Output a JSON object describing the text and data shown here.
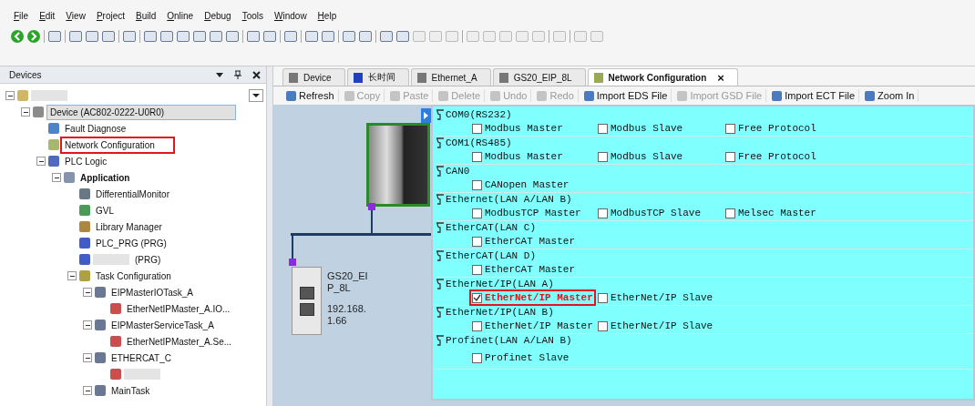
{
  "menu": [
    {
      "label": "File"
    },
    {
      "label": "Edit"
    },
    {
      "label": "View"
    },
    {
      "label": "Project"
    },
    {
      "label": "Build"
    },
    {
      "label": "Online"
    },
    {
      "label": "Debug"
    },
    {
      "label": "Tools"
    },
    {
      "label": "Window"
    },
    {
      "label": "Help"
    }
  ],
  "devices_panel": {
    "title": "Devices",
    "tree": [
      {
        "kind": "project",
        "redacted": true,
        "expanded": true,
        "children": [
          {
            "kind": "device",
            "label": "Device (AC802-0222-U0R0)",
            "selected": true,
            "expanded": true,
            "children": [
              {
                "kind": "diagnose",
                "label": "Fault Diagnose",
                "selected": false
              },
              {
                "kind": "network",
                "label": "Network Configuration",
                "highlighted": true,
                "selected": false
              },
              {
                "kind": "plc",
                "label": "PLC Logic",
                "expanded": true,
                "selected": false,
                "children": [
                  {
                    "kind": "application",
                    "label": "Application",
                    "active": true,
                    "expanded": true,
                    "selected": false,
                    "children": [
                      {
                        "kind": "monitor",
                        "label": "DifferentialMonitor",
                        "selected": false
                      },
                      {
                        "kind": "gvl",
                        "label": "GVL",
                        "selected": false
                      },
                      {
                        "kind": "library",
                        "label": "Library Manager",
                        "selected": false
                      },
                      {
                        "kind": "program",
                        "label": "PLC_PRG (PRG)",
                        "selected": false
                      },
                      {
                        "kind": "program",
                        "label": "(PRG)",
                        "redacted": true,
                        "selected": false
                      },
                      {
                        "kind": "taskconfig",
                        "label": "Task Configuration",
                        "expanded": true,
                        "selected": false,
                        "children": [
                          {
                            "kind": "task",
                            "label": "EIPMasterIOTask_A",
                            "expanded": true,
                            "selected": false,
                            "children": [
                              {
                                "kind": "call",
                                "label": "EtherNetIPMaster_A.IO...",
                                "selected": false
                              }
                            ]
                          },
                          {
                            "kind": "task",
                            "label": "EIPMasterServiceTask_A",
                            "expanded": true,
                            "selected": false,
                            "children": [
                              {
                                "kind": "call",
                                "label": "EtherNetIPMaster_A.Se...",
                                "selected": false
                              }
                            ]
                          },
                          {
                            "kind": "task",
                            "label": "ETHERCAT_C",
                            "expanded": true,
                            "selected": false,
                            "children": [
                              {
                                "kind": "call",
                                "redacted": true,
                                "selected": false
                              }
                            ]
                          },
                          {
                            "kind": "task",
                            "label": "MainTask",
                            "expanded": true,
                            "selected": false
                          }
                        ]
                      }
                    ]
                  }
                ]
              }
            ]
          }
        ]
      }
    ]
  },
  "tabs": [
    {
      "label": "Device",
      "kind": "device",
      "selected": false
    },
    {
      "label": "长时间",
      "kind": "program",
      "selected": false
    },
    {
      "label": "Ethernet_A",
      "kind": "device",
      "selected": false
    },
    {
      "label": "GS20_EIP_8L",
      "kind": "device",
      "selected": false
    },
    {
      "label": "Network Configuration",
      "kind": "network",
      "selected": true,
      "close": "×"
    }
  ],
  "toolbar": [
    {
      "label": "Refresh",
      "disabled": false
    },
    {
      "label": "Copy",
      "disabled": true
    },
    {
      "label": "Paste",
      "disabled": true
    },
    {
      "label": "Delete",
      "disabled": true
    },
    {
      "label": "Undo",
      "disabled": true
    },
    {
      "label": "Redo",
      "disabled": true
    },
    {
      "label": "Import EDS File",
      "disabled": false
    },
    {
      "label": "Import GSD File",
      "disabled": true
    },
    {
      "label": "Import ECT File",
      "disabled": false
    },
    {
      "label": "Zoom In",
      "disabled": false
    }
  ],
  "topology": {
    "node": {
      "name": "GS20_EIP_8L",
      "ip": "192.168.1.66"
    }
  },
  "protocols": [
    {
      "title": "COM0(RS232)",
      "options": [
        {
          "label": "Modbus Master",
          "checked": false
        },
        {
          "label": "Modbus Slave",
          "checked": false
        },
        {
          "label": "Free Protocol",
          "checked": false
        }
      ]
    },
    {
      "title": "COM1(RS485)",
      "options": [
        {
          "label": "Modbus Master",
          "checked": false
        },
        {
          "label": "Modbus Slave",
          "checked": false
        },
        {
          "label": "Free Protocol",
          "checked": false
        }
      ]
    },
    {
      "title": "CAN0",
      "options": [
        {
          "label": "CANopen Master",
          "checked": false
        }
      ]
    },
    {
      "title": "Ethernet(LAN A/LAN B)",
      "options": [
        {
          "label": "ModbusTCP Master",
          "checked": false
        },
        {
          "label": "ModbusTCP Slave",
          "checked": false
        },
        {
          "label": "Melsec Master",
          "checked": false
        }
      ]
    },
    {
      "title": "EtherCAT(LAN C)",
      "options": [
        {
          "label": "EtherCAT Master",
          "checked": false
        }
      ]
    },
    {
      "title": "EtherCAT(LAN D)",
      "options": [
        {
          "label": "EtherCAT Master",
          "checked": false
        }
      ]
    },
    {
      "title": "EtherNet/IP(LAN A)",
      "options": [
        {
          "label": "EtherNet/IP Master",
          "checked": true,
          "highlighted": true
        },
        {
          "label": "EtherNet/IP Slave",
          "checked": false
        }
      ]
    },
    {
      "title": "EtherNet/IP(LAN B)",
      "options": [
        {
          "label": "EtherNet/IP Master",
          "checked": false
        },
        {
          "label": "EtherNet/IP Slave",
          "checked": false
        }
      ]
    },
    {
      "title": "Profinet(LAN A/LAN B)",
      "options": [
        {
          "label": "Profinet Slave",
          "checked": false
        }
      ]
    }
  ]
}
